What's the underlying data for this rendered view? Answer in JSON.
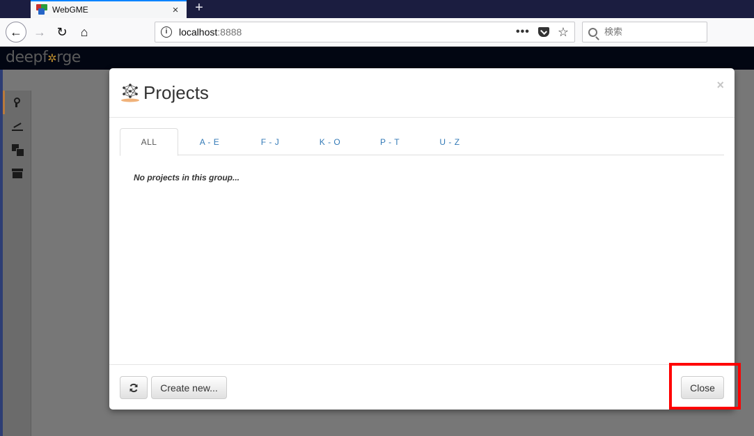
{
  "browser": {
    "tab_title": "WebGME",
    "tab_close_glyph": "×",
    "new_tab_glyph": "+",
    "url_host": "localhost",
    "url_port": ":8888",
    "url_more_glyph": "•••",
    "star_glyph": "☆",
    "search_placeholder": "検索",
    "back_glyph": "←",
    "forward_glyph": "→",
    "reload_glyph": "↻",
    "home_glyph": "⌂",
    "info_glyph": "i"
  },
  "app": {
    "logo_prefix": "deep",
    "logo_mid": "f",
    "logo_gear": "✲",
    "logo_suffix": "rge",
    "sidebar_icons": [
      "branch-icon",
      "chart-icon",
      "copy-icon",
      "archive-icon"
    ]
  },
  "modal": {
    "title": "Projects",
    "close_glyph": "×",
    "tabs": [
      {
        "label": "ALL",
        "active": true
      },
      {
        "label": "A - E",
        "active": false
      },
      {
        "label": "F - J",
        "active": false
      },
      {
        "label": "K - O",
        "active": false
      },
      {
        "label": "P - T",
        "active": false
      },
      {
        "label": "U - Z",
        "active": false
      }
    ],
    "empty_message": "No projects in this group...",
    "footer": {
      "create_label": "Create new...",
      "close_label": "Close"
    }
  },
  "colors": {
    "tab_strip": "#1b1d40",
    "link": "#337ab7",
    "highlight": "#ff0000",
    "brand_accent": "#b98a2c"
  }
}
